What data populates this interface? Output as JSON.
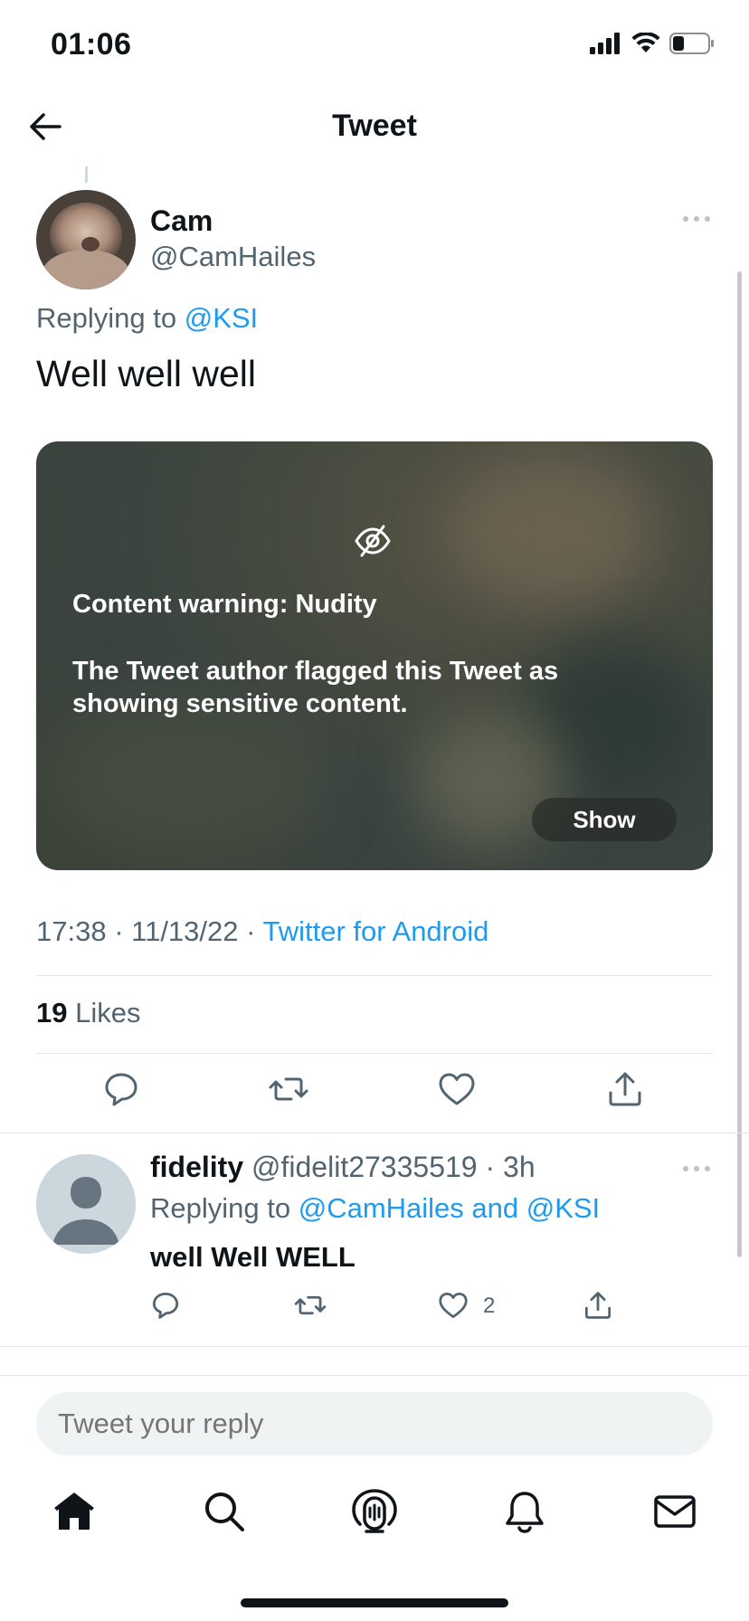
{
  "status_bar": {
    "time": "01:06"
  },
  "nav": {
    "title": "Tweet"
  },
  "tweet": {
    "author_name": "Cam",
    "author_handle": "@CamHailes",
    "replying_prefix": "Replying to",
    "replying_to": "@KSI",
    "text": "Well well well",
    "media": {
      "warning_title": "Content warning: Nudity",
      "warning_text": "The Tweet author flagged this Tweet as showing sensitive content.",
      "show_label": "Show"
    },
    "time": "17:38",
    "date": "11/13/22",
    "source": "Twitter for Android",
    "likes_count": "19",
    "likes_label": "Likes"
  },
  "reply": {
    "name": "fidelity",
    "handle": "@fidelit27335519",
    "age": "3h",
    "replying_prefix": "Replying to",
    "replying_to": "@CamHailes and @KSI",
    "text": "well Well WELL",
    "like_count": "2"
  },
  "compose": {
    "placeholder": "Tweet your reply"
  },
  "icons": {
    "back": "arrow-left-icon",
    "more": "more-horizontal-icon",
    "hidden": "eye-slash-icon",
    "reply": "comment-icon",
    "retweet": "retweet-icon",
    "like": "heart-icon",
    "share": "share-icon",
    "home": "home-icon",
    "search": "search-icon",
    "spaces": "spaces-icon",
    "notifications": "bell-icon",
    "messages": "mail-icon"
  },
  "colors": {
    "link": "#1d9bf0",
    "secondary_text": "#536471",
    "primary_text": "#0f1419"
  }
}
